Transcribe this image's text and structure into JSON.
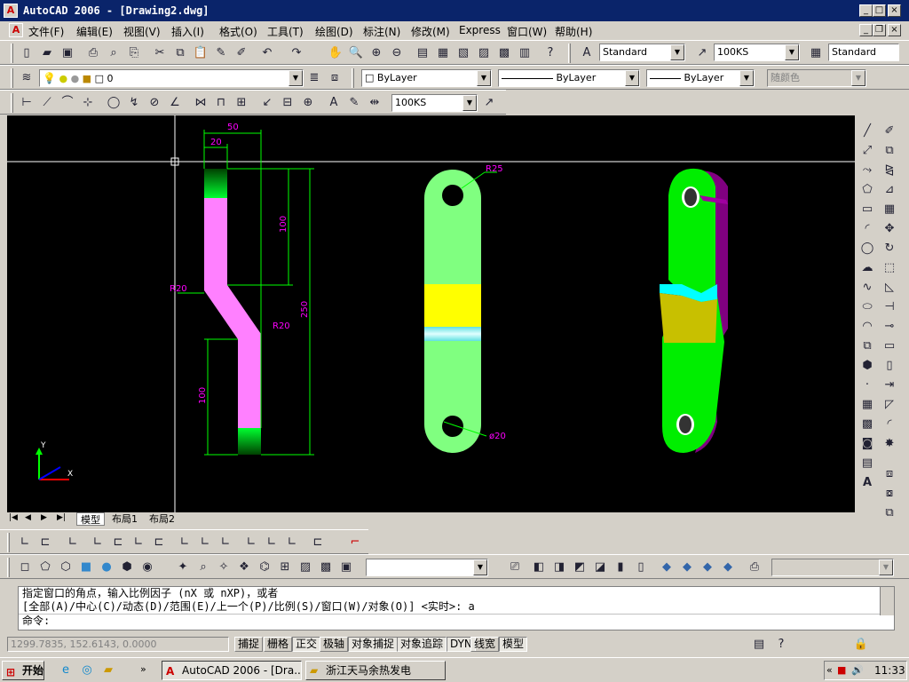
{
  "window": {
    "title": "AutoCAD 2006 - [Drawing2.dwg]"
  },
  "menu": [
    "文件(F)",
    "编辑(E)",
    "视图(V)",
    "插入(I)",
    "格式(O)",
    "工具(T)",
    "绘图(D)",
    "标注(N)",
    "修改(M)",
    "Express",
    "窗口(W)",
    "帮助(H)"
  ],
  "toolbar1": {
    "text_style": "Standard",
    "dim_style": "100KS",
    "table_style": "Standard"
  },
  "layers": {
    "current_layer": "0",
    "color": "ByLayer",
    "linetype": "ByLayer",
    "lineweight": "ByLayer",
    "plot_style": "随颜色"
  },
  "dimtoolbar": {
    "dim_style": "100KS"
  },
  "drawing": {
    "dims": {
      "top_width": "50",
      "inner_width": "20",
      "upper_height": "100",
      "total_height": "250",
      "lower_height": "100",
      "r_left": "R20",
      "r_right": "R20",
      "r_hole": "R25",
      "hole_dia": "ø20"
    }
  },
  "tabs": [
    "模型",
    "布局1",
    "布局2"
  ],
  "command": {
    "line1": "指定窗口的角点，输入比例因子 (nX 或 nXP)，或者",
    "line2": "[全部(A)/中心(C)/动态(D)/范围(E)/上一个(P)/比例(S)/窗口(W)/对象(O)] <实时>: a",
    "prompt": "命令:"
  },
  "status": {
    "coords": "1299.7835, 152.6143, 0.0000",
    "toggles": [
      "捕捉",
      "栅格",
      "正交",
      "极轴",
      "对象捕捉",
      "对象追踪",
      "DYN",
      "线宽",
      "模型"
    ]
  },
  "taskbar": {
    "start": "开始",
    "task1": "AutoCAD 2006 - [Dra...",
    "task2": "浙江天马余热发电",
    "time": "11:33"
  },
  "colors": {
    "titlebar": "#0a246a",
    "magenta": "#ff80ff",
    "green": "#00ff00",
    "yellow": "#ffff00",
    "cyan": "#00ffff",
    "purple": "#800080",
    "dim": "#ff00ff"
  }
}
